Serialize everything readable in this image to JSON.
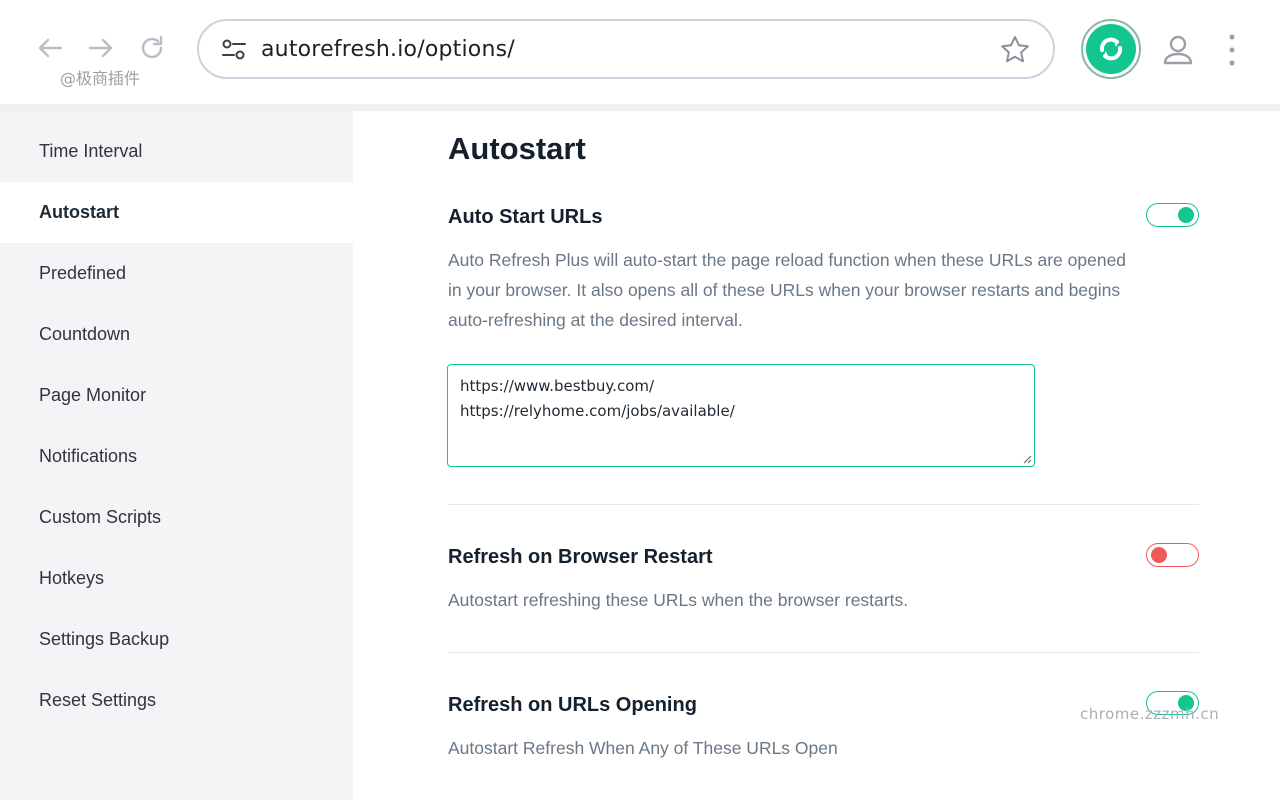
{
  "browser": {
    "url": "autorefresh.io/options/",
    "watermark_top": "@极商插件",
    "watermark_bottom": "chrome.zzzmh.cn"
  },
  "colors": {
    "accent": "#13c68f",
    "toggle_off": "#f25a5a",
    "sidebar_bg": "#f6f3f6"
  },
  "sidebar": {
    "items": [
      {
        "label": "Time Interval",
        "active": false
      },
      {
        "label": "Autostart",
        "active": true
      },
      {
        "label": "Predefined",
        "active": false
      },
      {
        "label": "Countdown",
        "active": false
      },
      {
        "label": "Page Monitor",
        "active": false
      },
      {
        "label": "Notifications",
        "active": false
      },
      {
        "label": "Custom Scripts",
        "active": false
      },
      {
        "label": "Hotkeys",
        "active": false
      },
      {
        "label": "Settings Backup",
        "active": false
      },
      {
        "label": "Reset Settings",
        "active": false
      }
    ]
  },
  "main": {
    "title": "Autostart",
    "sections": [
      {
        "title": "Auto Start URLs",
        "enabled": true,
        "description": "Auto Refresh Plus will auto-start the page reload function when these URLs are opened in your browser. It also opens all of these URLs when your browser restarts and begins auto-refreshing at the desired interval.",
        "urls": [
          "https://www.bestbuy.com/",
          "https://relyhome.com/jobs/available/"
        ]
      },
      {
        "title": "Refresh on Browser Restart",
        "enabled": false,
        "description": "Autostart refreshing these URLs when the browser restarts."
      },
      {
        "title": "Refresh on URLs Opening",
        "enabled": true,
        "description": "Autostart Refresh When Any of These URLs Open"
      }
    ]
  }
}
